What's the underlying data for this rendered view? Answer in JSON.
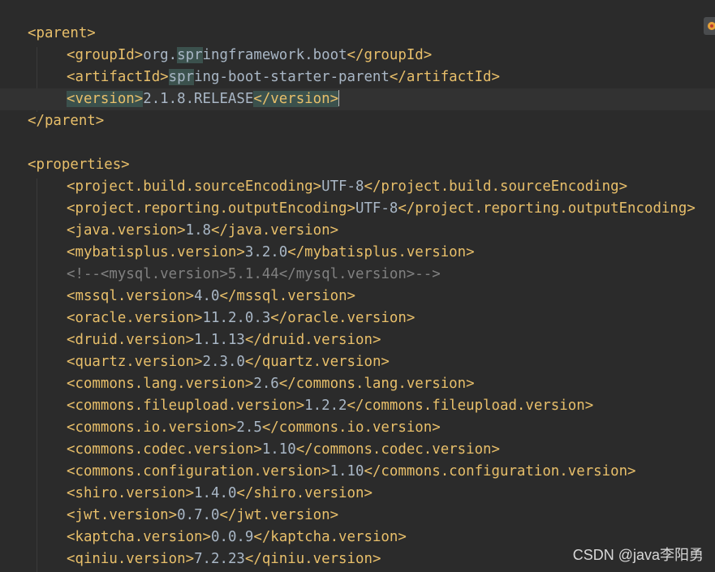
{
  "editor": {
    "language": "xml",
    "lines": [
      [
        {
          "t": "<parent>",
          "c": "tag"
        }
      ],
      [
        {
          "t": "<groupId>",
          "c": "tag"
        },
        {
          "t": "org.",
          "c": "text"
        },
        {
          "t": "spr",
          "c": "text match"
        },
        {
          "t": "ingframework.boot",
          "c": "text"
        },
        {
          "t": "</groupId>",
          "c": "tag"
        }
      ],
      [
        {
          "t": "<artifactId>",
          "c": "tag"
        },
        {
          "t": "spr",
          "c": "text match"
        },
        {
          "t": "ing-boot-starter-parent",
          "c": "text"
        },
        {
          "t": "</artifactId>",
          "c": "tag"
        }
      ],
      [
        {
          "t": "<version>",
          "c": "tag match"
        },
        {
          "t": "2.1.8.RELEASE",
          "c": "text"
        },
        {
          "t": "</version>",
          "c": "tag match"
        }
      ],
      [
        {
          "t": "</parent>",
          "c": "tag"
        }
      ],
      [],
      [
        {
          "t": "<properties>",
          "c": "tag"
        }
      ],
      [
        {
          "t": "<project.build.sourceEncoding>",
          "c": "tag"
        },
        {
          "t": "UTF-8",
          "c": "text"
        },
        {
          "t": "</project.build.sourceEncoding>",
          "c": "tag"
        }
      ],
      [
        {
          "t": "<project.reporting.outputEncoding>",
          "c": "tag"
        },
        {
          "t": "UTF-8",
          "c": "text"
        },
        {
          "t": "</project.reporting.outputEncoding>",
          "c": "tag"
        }
      ],
      [
        {
          "t": "<java.version>",
          "c": "tag"
        },
        {
          "t": "1.8",
          "c": "text"
        },
        {
          "t": "</java.version>",
          "c": "tag"
        }
      ],
      [
        {
          "t": "<mybatisplus.version>",
          "c": "tag"
        },
        {
          "t": "3.2.0",
          "c": "text"
        },
        {
          "t": "</mybatisplus.version>",
          "c": "tag"
        }
      ],
      [
        {
          "t": "<!--<mysql.version>5.1.44</mysql.version>-->",
          "c": "comment"
        }
      ],
      [
        {
          "t": "<mssql.version>",
          "c": "tag"
        },
        {
          "t": "4.0",
          "c": "text"
        },
        {
          "t": "</mssql.version>",
          "c": "tag"
        }
      ],
      [
        {
          "t": "<oracle.version>",
          "c": "tag"
        },
        {
          "t": "11.2.0.3",
          "c": "text"
        },
        {
          "t": "</oracle.version>",
          "c": "tag"
        }
      ],
      [
        {
          "t": "<druid.version>",
          "c": "tag"
        },
        {
          "t": "1.1.13",
          "c": "text"
        },
        {
          "t": "</druid.version>",
          "c": "tag"
        }
      ],
      [
        {
          "t": "<quartz.version>",
          "c": "tag"
        },
        {
          "t": "2.3.0",
          "c": "text"
        },
        {
          "t": "</quartz.version>",
          "c": "tag"
        }
      ],
      [
        {
          "t": "<commons.lang.version>",
          "c": "tag"
        },
        {
          "t": "2.6",
          "c": "text"
        },
        {
          "t": "</commons.lang.version>",
          "c": "tag"
        }
      ],
      [
        {
          "t": "<commons.fileupload.version>",
          "c": "tag"
        },
        {
          "t": "1.2.2",
          "c": "text"
        },
        {
          "t": "</commons.fileupload.version>",
          "c": "tag"
        }
      ],
      [
        {
          "t": "<commons.io.version>",
          "c": "tag"
        },
        {
          "t": "2.5",
          "c": "text"
        },
        {
          "t": "</commons.io.version>",
          "c": "tag"
        }
      ],
      [
        {
          "t": "<commons.codec.version>",
          "c": "tag"
        },
        {
          "t": "1.10",
          "c": "text"
        },
        {
          "t": "</commons.codec.version>",
          "c": "tag"
        }
      ],
      [
        {
          "t": "<commons.configuration.version>",
          "c": "tag"
        },
        {
          "t": "1.10",
          "c": "text"
        },
        {
          "t": "</commons.configuration.version>",
          "c": "tag"
        }
      ],
      [
        {
          "t": "<shiro.version>",
          "c": "tag"
        },
        {
          "t": "1.4.0",
          "c": "text"
        },
        {
          "t": "</shiro.version>",
          "c": "tag"
        }
      ],
      [
        {
          "t": "<jwt.version>",
          "c": "tag"
        },
        {
          "t": "0.7.0",
          "c": "text"
        },
        {
          "t": "</jwt.version>",
          "c": "tag"
        }
      ],
      [
        {
          "t": "<kaptcha.version>",
          "c": "tag"
        },
        {
          "t": "0.0.9",
          "c": "text"
        },
        {
          "t": "</kaptcha.version>",
          "c": "tag"
        }
      ],
      [
        {
          "t": "<qiniu.version>",
          "c": "tag"
        },
        {
          "t": "7.2.23",
          "c": "text"
        },
        {
          "t": "</qiniu.version>",
          "c": "tag"
        }
      ]
    ],
    "indents": [
      0,
      1,
      1,
      1,
      0,
      0,
      0,
      1,
      1,
      1,
      1,
      1,
      1,
      1,
      1,
      1,
      1,
      1,
      1,
      1,
      1,
      1,
      1,
      1,
      1
    ],
    "current_line": 3,
    "caret_after_segment": 2
  },
  "watermark": "CSDN @java李阳勇",
  "colors": {
    "background": "#2b2b2b",
    "tag": "#e8bf6a",
    "text": "#a9b7c6",
    "comment": "#808080",
    "match_highlight": "#3b514d",
    "current_line": "#323232"
  }
}
